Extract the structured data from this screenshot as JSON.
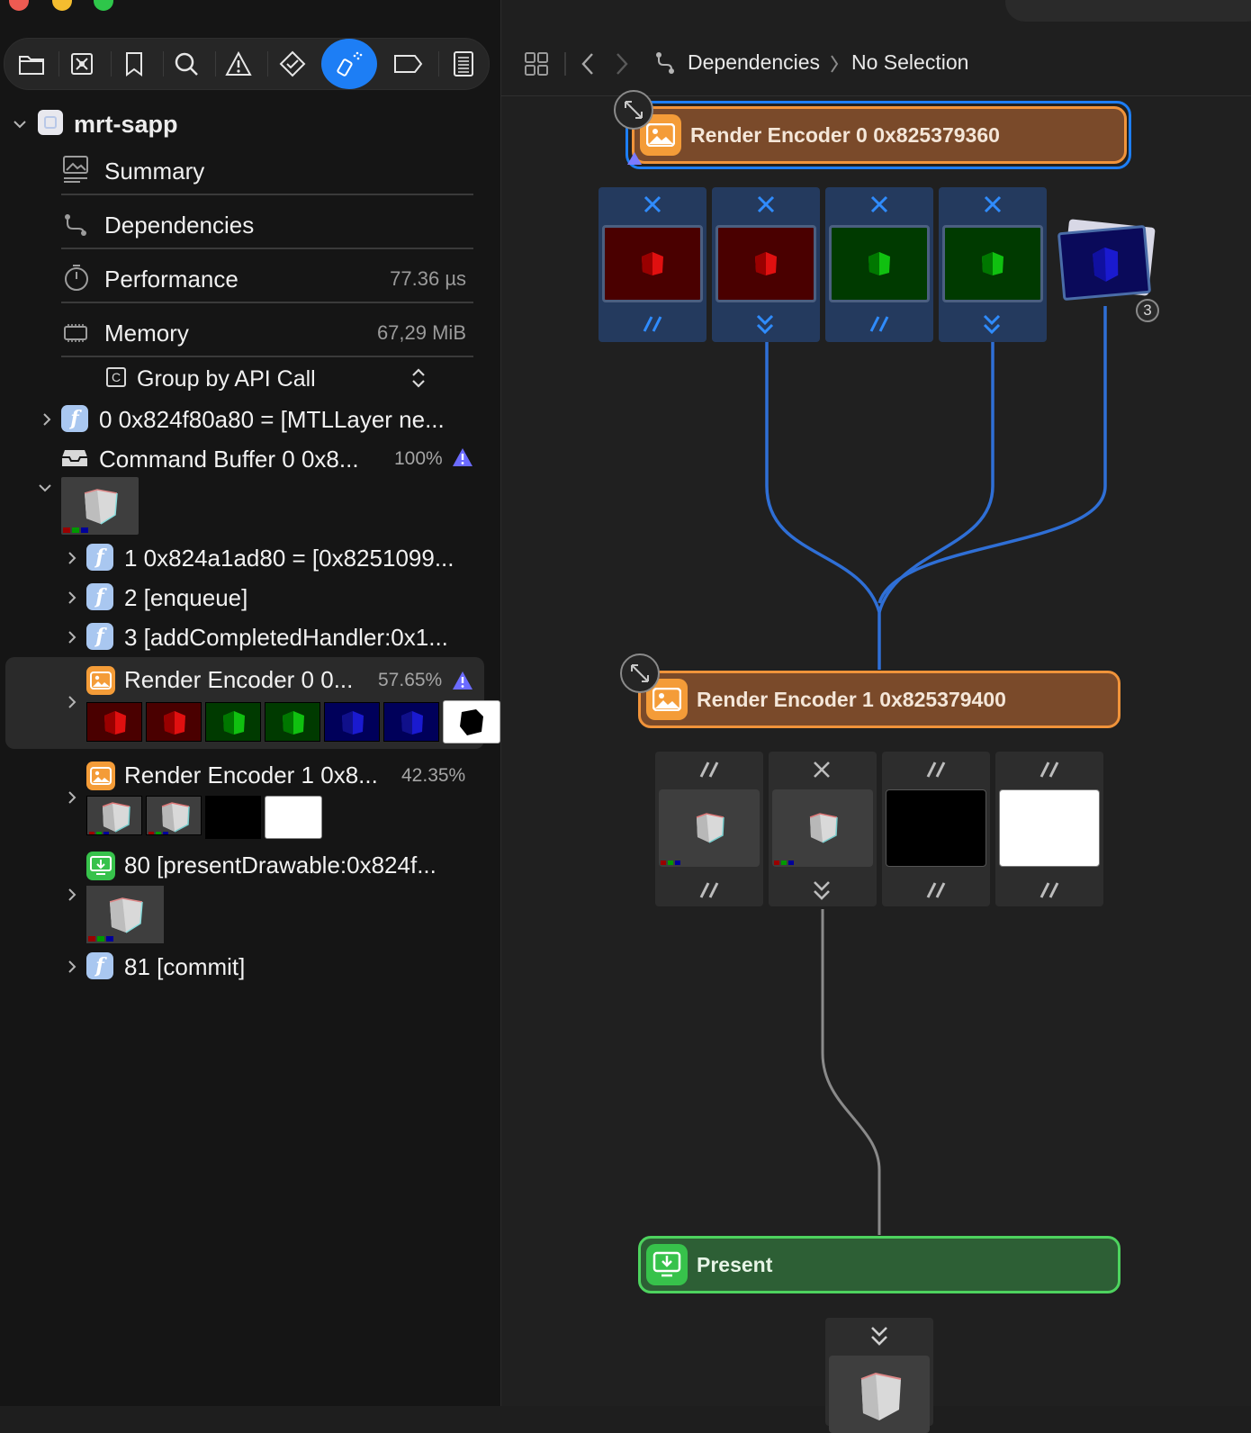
{
  "navigator": {
    "project": "mrt-sapp",
    "sections": [
      {
        "label": "Summary",
        "value": "",
        "icon": "summary-icon"
      },
      {
        "label": "Dependencies",
        "value": "",
        "icon": "dependencies-icon"
      },
      {
        "label": "Performance",
        "value": "77.36 µs",
        "icon": "stopwatch-icon"
      },
      {
        "label": "Memory",
        "value": "67,29 MiB",
        "icon": "memory-chip-icon"
      }
    ],
    "group_by": "Group by API Call",
    "tree": {
      "item0": "0 0x824f80a80 = [MTLLayer ne...",
      "command_buffer": "Command Buffer 0 0x8...",
      "command_buffer_pct": "100%",
      "item1": "1 0x824a1ad80 = [0x8251099...",
      "item2": "2 [enqueue]",
      "item3": "3 [addCompletedHandler:0x1...",
      "render_encoder0": "Render Encoder 0 0...",
      "render_encoder0_pct": "57.65%",
      "render_encoder1": "Render Encoder 1 0x8...",
      "render_encoder1_pct": "42.35%",
      "present": "80 [presentDrawable:0x824f...",
      "commit": "81 [commit]"
    }
  },
  "editor": {
    "breadcrumb": {
      "root": "Dependencies",
      "selection": "No Selection"
    },
    "nodes": {
      "encoder0": "Render Encoder 0 0x825379360",
      "encoder1": "Render Encoder 1 0x825379400",
      "present": "Present"
    },
    "stack_count": "3"
  },
  "colors": {
    "accent": "#1d7ef5",
    "encoder_fill": "#7a4a2a",
    "encoder_border": "#f0933a",
    "present_fill": "#2d5f35",
    "present_border": "#4dd35e",
    "edge_blue": "#2f6fd6",
    "edge_gray": "#8a8a8a",
    "warning": "#6b6bff"
  }
}
